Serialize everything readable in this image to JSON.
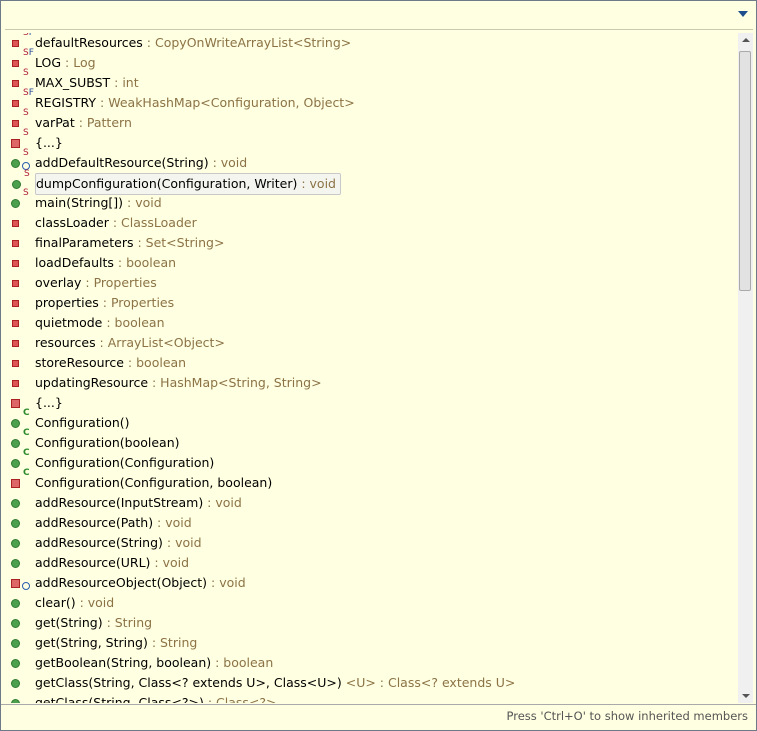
{
  "filter": {
    "value": ""
  },
  "items": [
    {
      "name": "defaultResources",
      "type": " : CopyOnWriteArrayList<String>",
      "vis": "priv",
      "ov": "SF"
    },
    {
      "name": "LOG",
      "type": " : Log",
      "vis": "priv",
      "ov": "SF"
    },
    {
      "name": "MAX_SUBST",
      "type": " : int",
      "vis": "priv",
      "ov": "S"
    },
    {
      "name": "REGISTRY",
      "type": " : WeakHashMap<Configuration, Object>",
      "vis": "priv",
      "ov": "SF"
    },
    {
      "name": "varPat",
      "type": " : Pattern",
      "vis": "priv",
      "ov": "S"
    },
    {
      "name": "{...}",
      "type": "",
      "vis": "privb",
      "ov": "S"
    },
    {
      "name": "addDefaultResource(String)",
      "type": " : void",
      "vis": "pub",
      "ov": "S",
      "sync": true
    },
    {
      "name": "dumpConfiguration(Configuration, Writer)",
      "type": " : void",
      "vis": "pub",
      "ov": "S",
      "selected": true
    },
    {
      "name": "main(String[])",
      "type": " : void",
      "vis": "pub",
      "ov": "S"
    },
    {
      "name": "classLoader",
      "type": " : ClassLoader",
      "vis": "priv",
      "ov": ""
    },
    {
      "name": "finalParameters",
      "type": " : Set<String>",
      "vis": "priv",
      "ov": ""
    },
    {
      "name": "loadDefaults",
      "type": " : boolean",
      "vis": "priv",
      "ov": ""
    },
    {
      "name": "overlay",
      "type": " : Properties",
      "vis": "priv",
      "ov": ""
    },
    {
      "name": "properties",
      "type": " : Properties",
      "vis": "priv",
      "ov": ""
    },
    {
      "name": "quietmode",
      "type": " : boolean",
      "vis": "priv",
      "ov": ""
    },
    {
      "name": "resources",
      "type": " : ArrayList<Object>",
      "vis": "priv",
      "ov": ""
    },
    {
      "name": "storeResource",
      "type": " : boolean",
      "vis": "priv",
      "ov": ""
    },
    {
      "name": "updatingResource",
      "type": " : HashMap<String, String>",
      "vis": "priv",
      "ov": ""
    },
    {
      "name": "{...}",
      "type": "",
      "vis": "privb",
      "ov": ""
    },
    {
      "name": "Configuration()",
      "type": "",
      "vis": "pub",
      "ov": "C"
    },
    {
      "name": "Configuration(boolean)",
      "type": "",
      "vis": "pub",
      "ov": "C"
    },
    {
      "name": "Configuration(Configuration)",
      "type": "",
      "vis": "pub",
      "ov": "C"
    },
    {
      "name": "Configuration(Configuration, boolean)",
      "type": "",
      "vis": "privb",
      "ov": "C"
    },
    {
      "name": "addResource(InputStream)",
      "type": " : void",
      "vis": "pub",
      "ov": ""
    },
    {
      "name": "addResource(Path)",
      "type": " : void",
      "vis": "pub",
      "ov": ""
    },
    {
      "name": "addResource(String)",
      "type": " : void",
      "vis": "pub",
      "ov": ""
    },
    {
      "name": "addResource(URL)",
      "type": " : void",
      "vis": "pub",
      "ov": ""
    },
    {
      "name": "addResourceObject(Object)",
      "type": " : void",
      "vis": "privb",
      "ov": "",
      "sync": true
    },
    {
      "name": "clear()",
      "type": " : void",
      "vis": "pub",
      "ov": ""
    },
    {
      "name": "get(String)",
      "type": " : String",
      "vis": "pub",
      "ov": ""
    },
    {
      "name": "get(String, String)",
      "type": " : String",
      "vis": "pub",
      "ov": ""
    },
    {
      "name": "getBoolean(String, boolean)",
      "type": " : boolean",
      "vis": "pub",
      "ov": ""
    },
    {
      "name": "getClass(String, Class<? extends U>, Class<U>)",
      "type": " <U> : Class<? extends U>",
      "vis": "pub",
      "ov": ""
    },
    {
      "name": "getClass(String, Class<?>)",
      "type": " : Class<?>",
      "vis": "pub",
      "ov": ""
    }
  ],
  "status": "Press 'Ctrl+O' to show inherited members"
}
